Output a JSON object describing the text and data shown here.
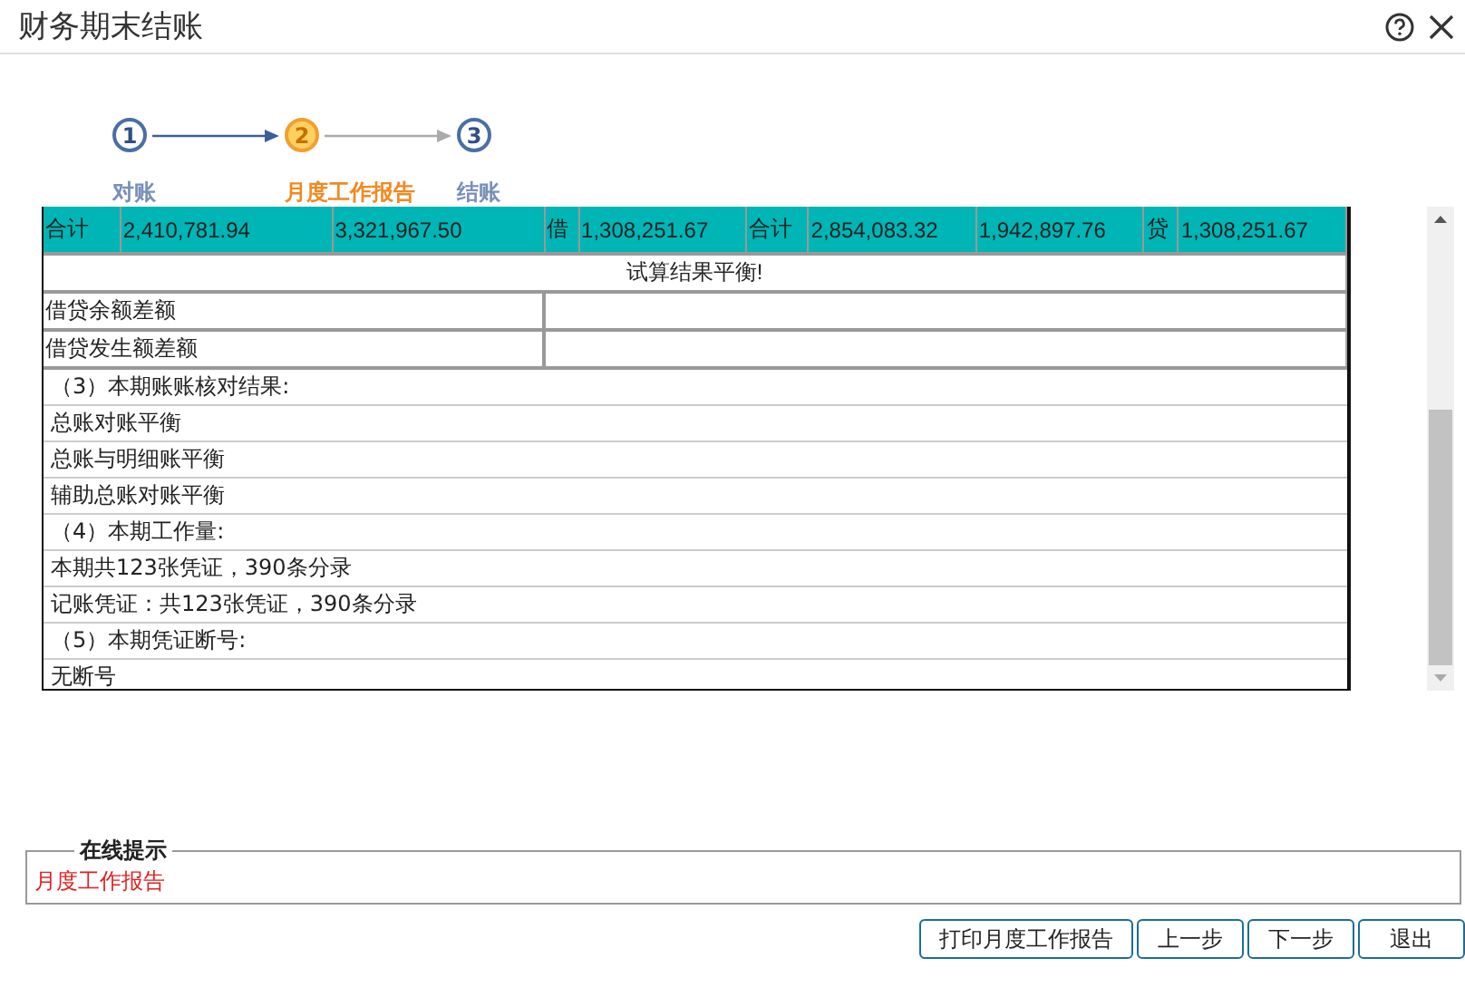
{
  "window": {
    "title": "财务期末结账"
  },
  "steps": [
    {
      "number": "1",
      "label": "对账",
      "selected": false
    },
    {
      "number": "2",
      "label": "月度工作报告",
      "selected": true
    },
    {
      "number": "3",
      "label": "结账",
      "selected": false
    }
  ],
  "report": {
    "totals_row": [
      "合计",
      "2,410,781.94",
      "3,321,967.50",
      "借",
      "1,308,251.67",
      "合计",
      "2,854,083.32",
      "1,942,897.76",
      "贷",
      "1,308,251.67"
    ],
    "balance_message": "试算结果平衡!",
    "difference_rows": [
      "借贷余额差额",
      "借贷发生额差额"
    ],
    "lines": [
      "（3）本期账账核对结果:",
      "总账对账平衡",
      "总账与明细账平衡",
      "辅助总账对账平衡",
      "（4）本期工作量:",
      "本期共123张凭证，390条分录",
      "记账凭证：共123张凭证，390条分录",
      "（5）本期凭证断号:",
      "无断号"
    ]
  },
  "online_tip": {
    "title": "在线提示",
    "message": "月度工作报告"
  },
  "buttons": [
    "打印月度工作报告",
    "上一步",
    "下一步",
    "退出"
  ]
}
